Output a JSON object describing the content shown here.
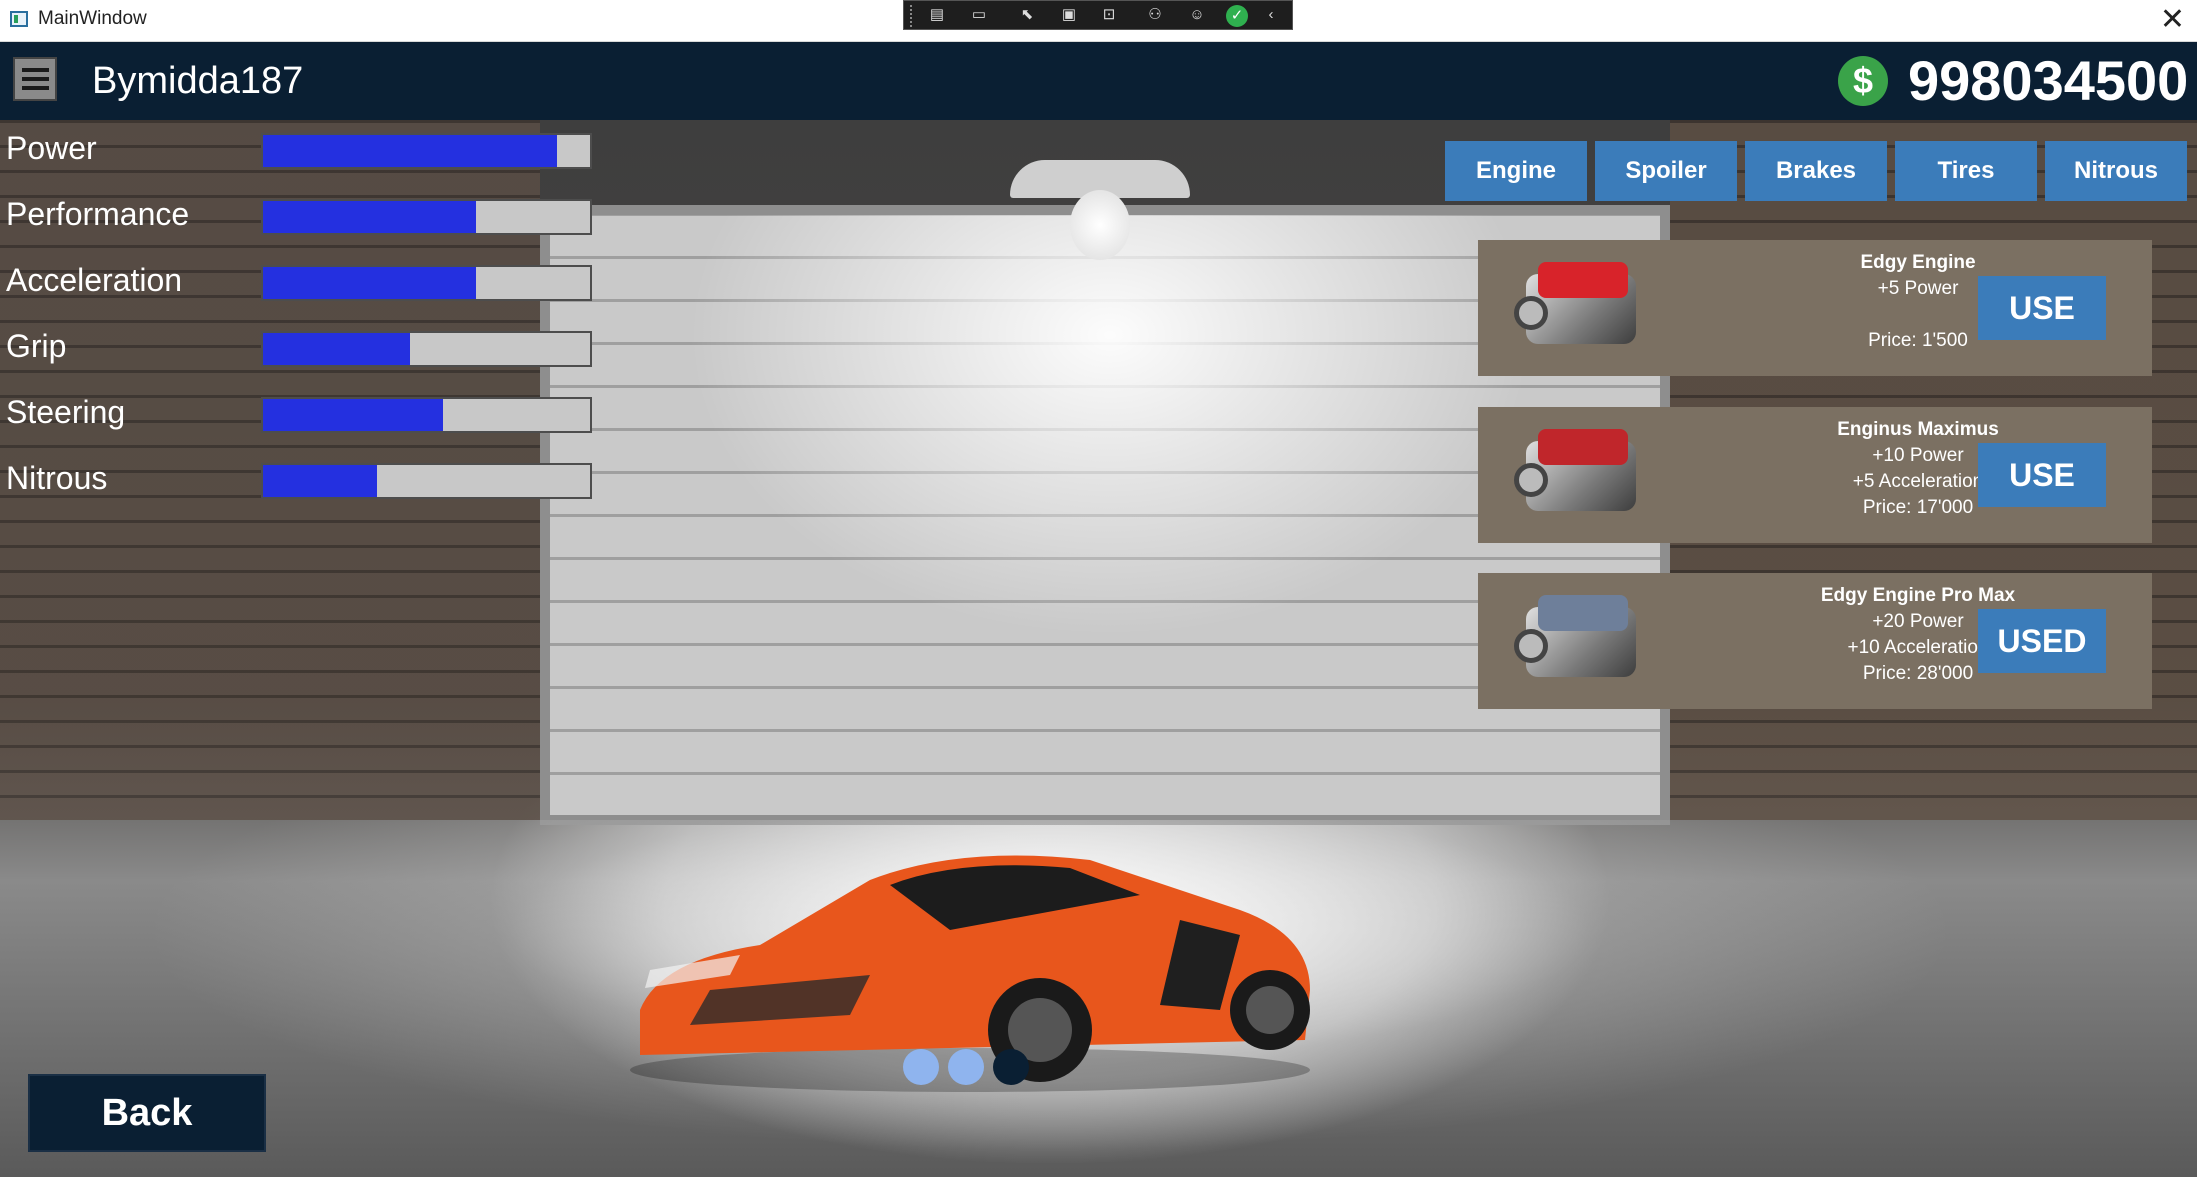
{
  "window": {
    "title": "MainWindow",
    "close_glyph": "✕"
  },
  "header": {
    "username": "Bymidda187",
    "currency_symbol": "$",
    "balance": "998034500"
  },
  "stats": [
    {
      "label": "Power",
      "level": 0.9
    },
    {
      "label": "Performance",
      "level": 0.65
    },
    {
      "label": "Acceleration",
      "level": 0.65
    },
    {
      "label": "Grip",
      "level": 0.45
    },
    {
      "label": "Steering",
      "level": 0.55
    },
    {
      "label": "Nitrous",
      "level": 0.35
    }
  ],
  "tabs": [
    "Engine",
    "Spoiler",
    "Brakes",
    "Tires",
    "Nitrous"
  ],
  "items": [
    {
      "name": "Edgy Engine",
      "line1": "+5 Power",
      "line2": "",
      "price": "Price: 1'500",
      "button": "USE",
      "cover_color": "#d8232a"
    },
    {
      "name": "Enginus Maximus",
      "line1": "+10 Power",
      "line2": "+5 Acceleration",
      "price": "Price: 17'000",
      "button": "USE",
      "cover_color": "#c0262b"
    },
    {
      "name": "Edgy Engine Pro Max",
      "line1": "+20 Power",
      "line2": "+10 Acceleration",
      "price": "Price: 28'000",
      "button": "USED",
      "cover_color": "#6e7f9a"
    }
  ],
  "pager": {
    "active_index": 2,
    "count": 3
  },
  "footer": {
    "back_label": "Back"
  },
  "colors": {
    "header_bg": "#0a1f33",
    "stat_fill": "#2430e0",
    "button_blue": "#3b7cba",
    "card_bg": "#7b7062",
    "car_orange": "#e8561c"
  }
}
